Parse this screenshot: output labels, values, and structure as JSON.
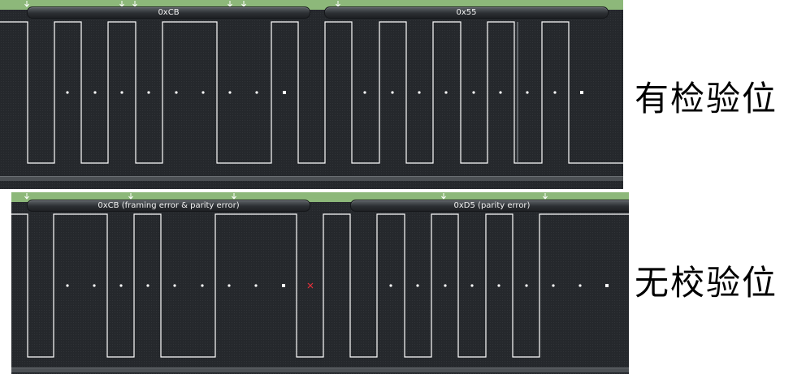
{
  "panels": {
    "with_parity": {
      "decodes": [
        "0xCB",
        "0x55"
      ]
    },
    "without_parity": {
      "decodes": [
        "0xCB (framing error & parity error)",
        "0xD5 (parity error)"
      ]
    }
  },
  "labels": {
    "with_parity": "有检验位",
    "without_parity": "无校验位"
  },
  "colors": {
    "panel_background": "#25282c",
    "signal_line": "#ffffff",
    "marker_strip": "#8db87a",
    "error_marker": "#e0303a"
  },
  "icons": [
    "down-arrow-marker-icon",
    "sample-dot-icon",
    "stop-bit-square-icon",
    "error-cross-icon"
  ]
}
